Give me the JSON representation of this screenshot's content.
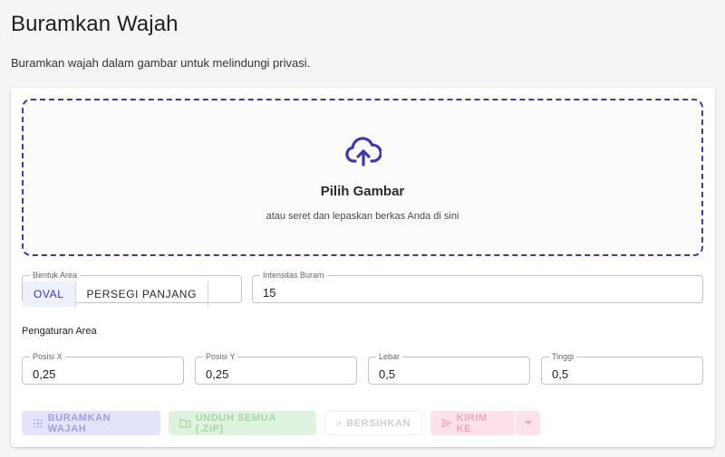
{
  "page": {
    "title": "Buramkan Wajah",
    "subtitle": "Buramkan wajah dalam gambar untuk melindungi privasi."
  },
  "dropzone": {
    "icon": "cloud-upload-icon",
    "title": "Pilih Gambar",
    "hint": "atau seret dan lepaskan berkas Anda di sini"
  },
  "shape": {
    "label": "Bentuk Area",
    "options": [
      "OVAL",
      "PERSEGI PANJANG"
    ],
    "selected": "OVAL"
  },
  "intensity": {
    "label": "Intensitas Buram",
    "value": "15"
  },
  "area_settings": {
    "label": "Pengaturan Area",
    "fields": [
      {
        "label": "Posisi X",
        "value": "0,25"
      },
      {
        "label": "Posisi Y",
        "value": "0,25"
      },
      {
        "label": "Lebar",
        "value": "0,5"
      },
      {
        "label": "Tinggi",
        "value": "0,5"
      }
    ]
  },
  "actions": {
    "blur": "BURAMKAN WAJAH",
    "download_zip": "UNDUH SEMUA (.ZIP)",
    "clear": "BERSIHKAN",
    "send_to": "KIRIM KE"
  },
  "colors": {
    "accent": "#3f3aa8",
    "blur_button_bg": "#e3e3fb",
    "zip_button_bg": "#dff1df",
    "send_button_bg": "#fde2ea"
  }
}
